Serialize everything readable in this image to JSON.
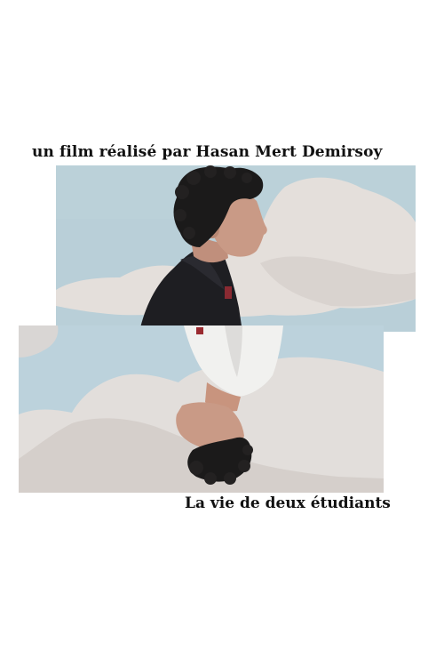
{
  "poster": {
    "credit": "un film réalisé par Hasan Mert Demirsoy",
    "subtitle": "La vie de deux étudiants"
  },
  "colors": {
    "background": "#ffffff",
    "text": "#111111",
    "sky": "#b9cfd8",
    "cloud": "#e4dfdb",
    "hair": "#1b1a1a",
    "skin": "#c99a86",
    "shirt_dark": "#1e1e22",
    "shirt_white": "#f1f1ef"
  },
  "images": {
    "top": "photo-man-profile-in-front-of-cloud-mural",
    "bottom": "photo-man-upside-down-in-front-of-cloud-mural"
  }
}
